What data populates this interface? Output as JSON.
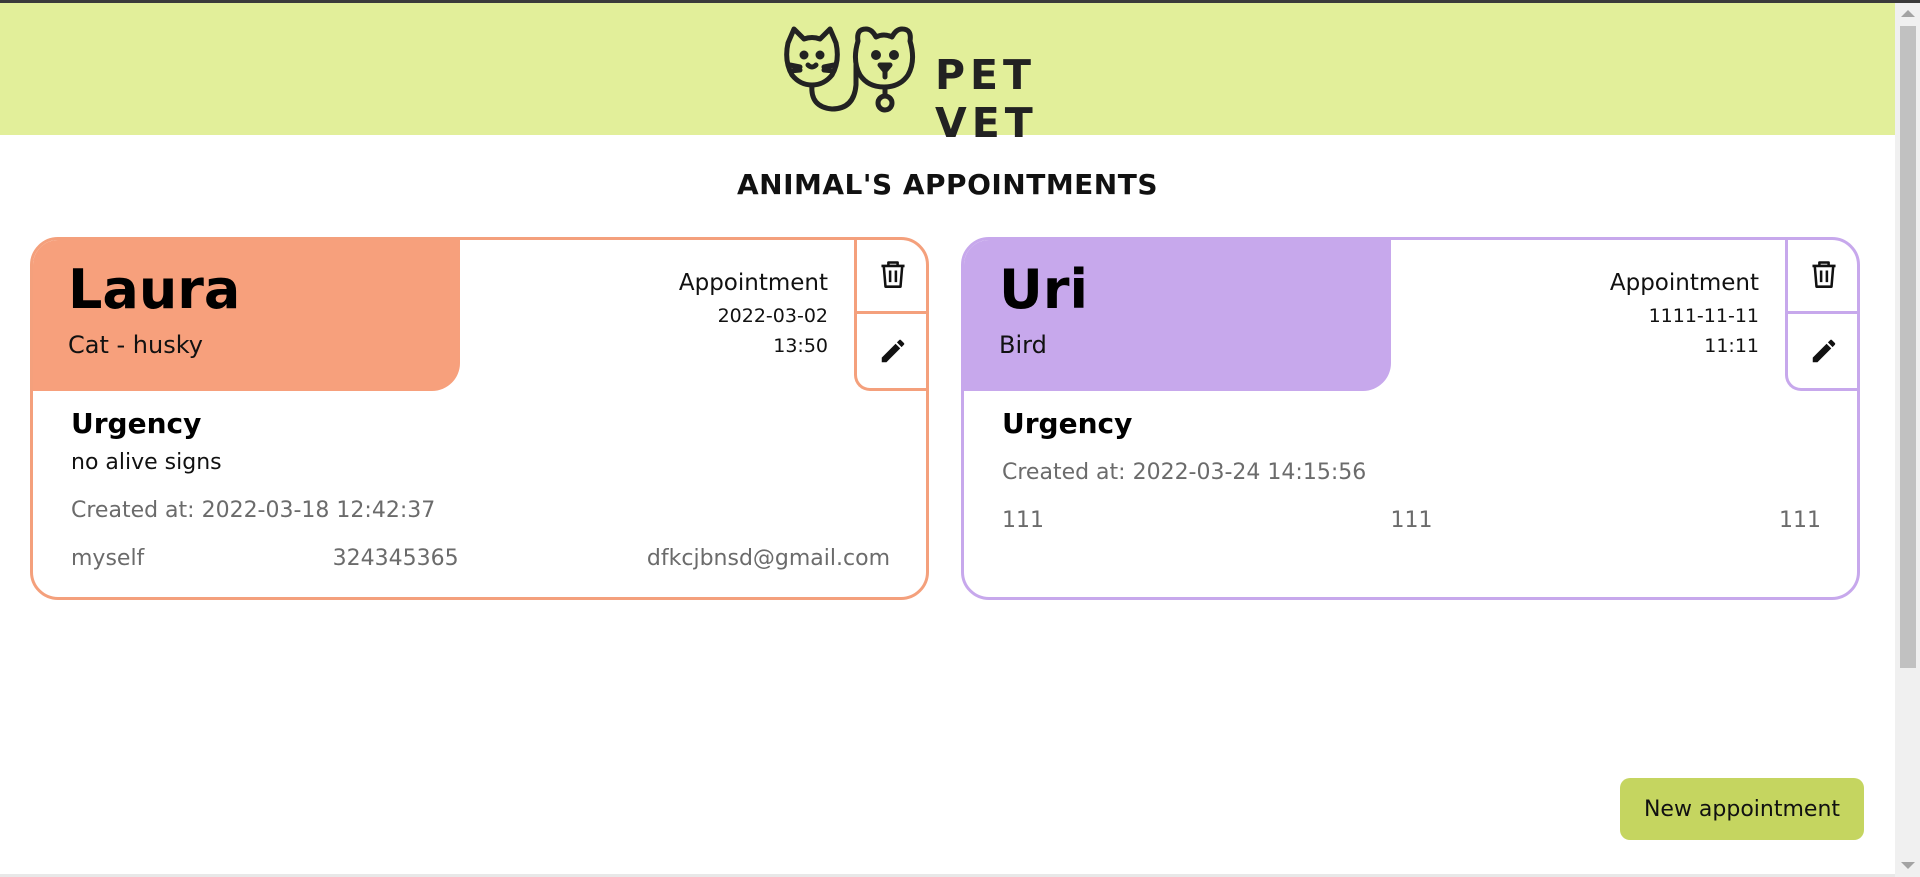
{
  "header": {
    "logo_text": "PET VET"
  },
  "page_title": "ANIMAL'S APPOINTMENTS",
  "appointments": [
    {
      "name": "Laura",
      "type": "Cat - husky",
      "appointment_label": "Appointment",
      "date": "2022-03-02",
      "time": "13:50",
      "urgency_label": "Urgency",
      "urgency_text": "no alive signs",
      "created": "Created at: 2022-03-18 12:42:37",
      "owner": "myself",
      "phone": "324345365",
      "email": "dfkcjbnsd@gmail.com",
      "color": "#f7a07c"
    },
    {
      "name": "Uri",
      "type": "Bird",
      "appointment_label": "Appointment",
      "date": "1111-11-11",
      "time": "11:11",
      "urgency_label": "Urgency",
      "urgency_text": "",
      "created": "Created at: 2022-03-24 14:15:56",
      "owner": "111",
      "phone": "111",
      "email": "111",
      "color": "#c7a8ec"
    }
  ],
  "icons": {
    "delete": "trash-icon",
    "edit": "pencil-icon"
  },
  "new_appointment_label": "New appointment",
  "colors": {
    "header_bg": "#e2ef9a",
    "button_bg": "#c5d560"
  }
}
